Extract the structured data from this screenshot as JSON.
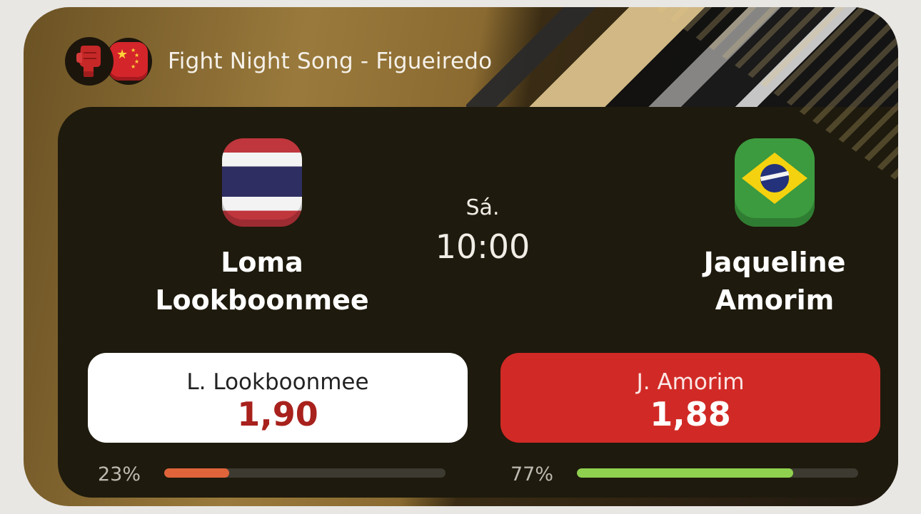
{
  "event": {
    "title": "Fight Night Song - Figueiredo",
    "sport_icon": "mma-glove-icon",
    "country_flag": "china-flag-icon"
  },
  "match": {
    "day": "Sá.",
    "time": "10:00"
  },
  "fighters": {
    "left": {
      "name_line1": "Loma",
      "name_line2": "Lookboonmee",
      "flag": "thailand-flag-icon"
    },
    "right": {
      "name_line1": "Jaqueline",
      "name_line2": "Amorim",
      "flag": "brazil-flag-icon"
    }
  },
  "odds": {
    "left": {
      "label": "L. Lookboonmee",
      "value": "1,90"
    },
    "right": {
      "label": "J. Amorim",
      "value": "1,88"
    }
  },
  "bets": {
    "left": {
      "percent_text": "23%",
      "fraction": 0.23,
      "color": "#e0643a"
    },
    "right": {
      "percent_text": "77%",
      "fraction": 0.77,
      "color": "#8fd14f"
    }
  },
  "colors": {
    "accent_red": "#d12a26",
    "panel": "#1e1a0d",
    "odds_text_dark_red": "#a8211c"
  }
}
